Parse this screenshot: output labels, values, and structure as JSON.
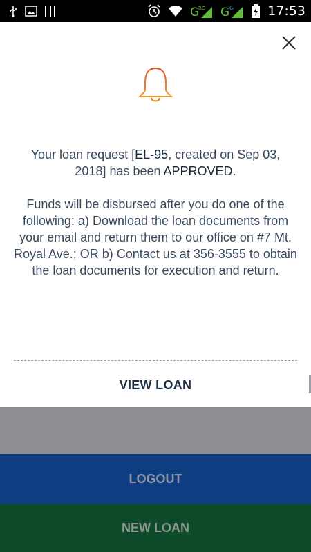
{
  "status_bar": {
    "time": "17:53",
    "left_icons": [
      "usb-icon",
      "image-icon",
      "barcode-icon"
    ],
    "right_icons": [
      "alarm-icon",
      "wifi-icon",
      "signal-icon",
      "signal-icon",
      "battery-icon"
    ],
    "signal_labels": [
      "G",
      "RG",
      "G",
      "G"
    ]
  },
  "dialog": {
    "icon": "bell-icon",
    "accent_color": "#e8501f",
    "message": {
      "line1_pre": "Your loan request [",
      "loan_id": "EL-95",
      "line1_mid": ", created on Sep 03, 2018] has been ",
      "status": "APPROVED",
      "line1_post": ".",
      "paragraph2": "Funds will be disbursed after you do one of the following: a) Download the loan documents from your email and return them to our office on #7 Mt. Royal Ave.; OR b) Contact us at 356-3555 to obtain the loan documents for execution and return."
    },
    "view_loan_label": "VIEW LOAN"
  },
  "background": {
    "logout_label": "LOGOUT",
    "new_loan_label": "NEW LOAN"
  }
}
